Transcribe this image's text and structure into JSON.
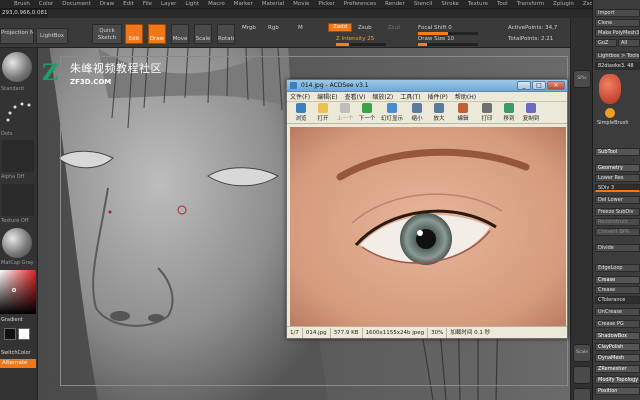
{
  "menubar": {
    "items": [
      "Brush",
      "Color",
      "Document",
      "Draw",
      "Edit",
      "File",
      "Layer",
      "Light",
      "Macro",
      "Marker",
      "Material",
      "Movie",
      "Picker",
      "Preferences",
      "Render",
      "Stencil",
      "Stroke",
      "Texture",
      "Tool",
      "Transform",
      "Zplugin",
      "Zscript"
    ]
  },
  "coords": "293,0.966,0.081",
  "toolbar": {
    "projection_master": "Projection Master",
    "lightbox": "LightBox",
    "quick_sketch": "Quick Sketch",
    "edit": "Edit",
    "draw": "Draw",
    "move": "Move",
    "scale": "Scale",
    "rotate": "Rotate",
    "mrgb": "Mrgb",
    "rgb": "Rgb",
    "m": "M",
    "zadd": "Zadd",
    "zsub": "Zsub",
    "zcut": "Zcut",
    "focal_shift": "Focal Shift 0",
    "z_intensity": "Z Intensity 25",
    "draw_size": "Draw Size 10",
    "active_points": "ActivePoints: 34,7",
    "total_points": "TotalPoints: 2.21",
    "accent": "#f07818"
  },
  "left": {
    "standard_label": "Standard",
    "dots_label": "Dots",
    "alpha_label": "Alpha Off",
    "texture_label": "Texture Off",
    "material_label": "MatCap Gray",
    "gradient_label": "Gradient",
    "switch_color": "SwitchColor",
    "alternate": "Alternate"
  },
  "right_col": {
    "spix": "SPix",
    "scale": "Scale"
  },
  "rpanel": {
    "items": [
      "Import",
      "Clone",
      "Make PolyMesh3D",
      "Clone All",
      "GoZ",
      "All",
      "Lightbox > Tools",
      "82diaoke3. 48",
      "SimpleBrush",
      "SubTool",
      "Geometry",
      "Lower Res",
      "SDiv 3",
      "Del Lower",
      "Freeze SubDiv",
      "Reconstruct",
      "Convert BPR",
      "Divide",
      "EdgeLoop",
      "Crease",
      "Crease",
      "CTolerance",
      "UnCrease",
      "Crease PG",
      "ShadowBox",
      "ClayPolish",
      "DynaMesh",
      "ZRemesher",
      "Modify Topology",
      "Position"
    ]
  },
  "watermark": {
    "cn": "朱峰视频教程社区",
    "en": "ZF3D.COM"
  },
  "acdsee": {
    "title": "014.jpg - ACDSee v3.1",
    "menu": [
      "文件(F)",
      "编辑(E)",
      "查看(V)",
      "缩放(Z)",
      "工具(T)",
      "插件(P)",
      "帮助(H)"
    ],
    "tools": [
      {
        "label": "浏览",
        "icon": "browse-icon",
        "color": "#3a7fc0"
      },
      {
        "label": "打开",
        "icon": "open-folder-icon",
        "color": "#e8c050"
      },
      {
        "label": "上一个",
        "icon": "previous-icon",
        "color": "#9a9a9a",
        "disabled": true
      },
      {
        "label": "下一个",
        "icon": "next-icon",
        "color": "#3aa04a"
      },
      {
        "label": "幻灯显示",
        "icon": "slideshow-icon",
        "color": "#4a8ad0"
      },
      {
        "label": "缩小",
        "icon": "zoom-out-icon",
        "color": "#5a7aa0"
      },
      {
        "label": "放大",
        "icon": "zoom-in-icon",
        "color": "#5a7aa0"
      },
      {
        "label": "编辑",
        "icon": "edit-icon",
        "color": "#c06030"
      },
      {
        "label": "打印",
        "icon": "print-icon",
        "color": "#707070"
      },
      {
        "label": "移到",
        "icon": "move-to-icon",
        "color": "#3a9a6a"
      },
      {
        "label": "复制到",
        "icon": "copy-to-icon",
        "color": "#6a6ac0"
      }
    ],
    "status": {
      "index": "1/7",
      "file": "014.jpg",
      "size": "377.9 KB",
      "dims": "1600x1155x24b jpeg",
      "zoom": "30%",
      "load": "加载时间 0.1 秒"
    }
  }
}
